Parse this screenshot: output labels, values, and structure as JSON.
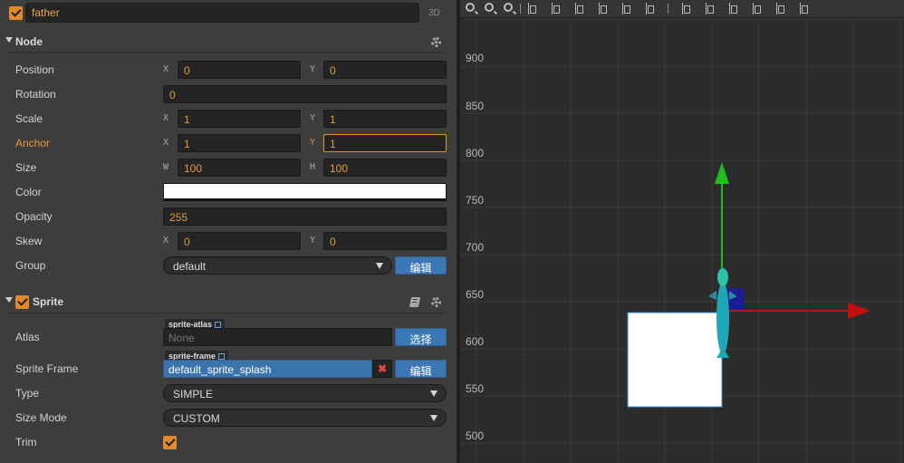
{
  "node_header": {
    "name": "father",
    "mode_label": "3D",
    "active": true
  },
  "node_section": {
    "title": "Node",
    "properties": {
      "position": {
        "label": "Position",
        "x_axis": "X",
        "x": "0",
        "y_axis": "Y",
        "y": "0"
      },
      "rotation": {
        "label": "Rotation",
        "value": "0"
      },
      "scale": {
        "label": "Scale",
        "x_axis": "X",
        "x": "1",
        "y_axis": "Y",
        "y": "1"
      },
      "anchor": {
        "label": "Anchor",
        "x_axis": "X",
        "x": "1",
        "y_axis": "Y",
        "y": "1"
      },
      "size": {
        "label": "Size",
        "w_axis": "W",
        "w": "100",
        "h_axis": "H",
        "h": "100"
      },
      "color": {
        "label": "Color",
        "value": "#ffffff"
      },
      "opacity": {
        "label": "Opacity",
        "value": "255"
      },
      "skew": {
        "label": "Skew",
        "x_axis": "X",
        "x": "0",
        "y_axis": "Y",
        "y": "0"
      },
      "group": {
        "label": "Group",
        "value": "default",
        "edit_label": "编辑"
      }
    }
  },
  "sprite_section": {
    "title": "Sprite",
    "enabled": true,
    "properties": {
      "atlas": {
        "label": "Atlas",
        "tag": "sprite-atlas",
        "value": "None",
        "choose_label": "选择"
      },
      "sprite_frame": {
        "label": "Sprite Frame",
        "tag": "sprite-frame",
        "value": "default_sprite_splash",
        "edit_label": "编辑"
      },
      "type": {
        "label": "Type",
        "value": "SIMPLE"
      },
      "size_mode": {
        "label": "Size Mode",
        "value": "CUSTOM"
      },
      "trim": {
        "label": "Trim",
        "checked": true
      }
    }
  },
  "scene": {
    "y_ruler": [
      "900",
      "850",
      "800",
      "750",
      "700",
      "650",
      "600",
      "550",
      "500"
    ],
    "toolbar_icons": [
      "zoom-in-icon",
      "zoom-out-icon",
      "zoom-reset-icon",
      "align-left-icon",
      "align-h-center-icon",
      "align-right-icon",
      "align-top-icon",
      "align-v-center-icon",
      "align-bottom-icon",
      "distribute-top-icon",
      "distribute-v-center-icon",
      "distribute-bottom-icon",
      "distribute-left-icon",
      "distribute-right-icon"
    ],
    "colors": {
      "y_axis_gizmo": "#1fbf1f",
      "x_axis_gizmo": "#c21010",
      "sprite": "#ffffff",
      "origin_box": "#1a1aa6"
    }
  }
}
